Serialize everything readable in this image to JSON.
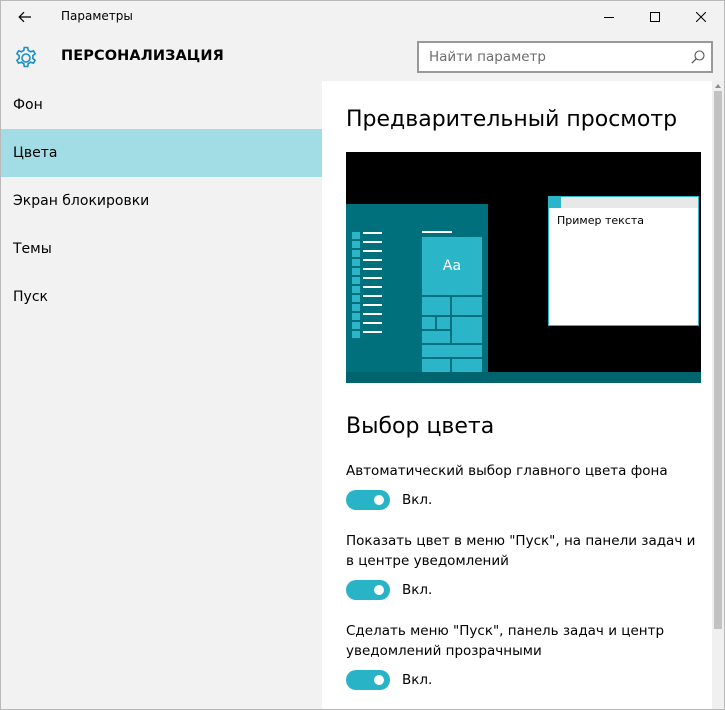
{
  "window": {
    "title": "Параметры"
  },
  "header": {
    "title": "ПЕРСОНАЛИЗАЦИЯ",
    "search_placeholder": "Найти параметр"
  },
  "sidebar": {
    "items": [
      {
        "label": "Фон",
        "active": false
      },
      {
        "label": "Цвета",
        "active": true
      },
      {
        "label": "Экран блокировки",
        "active": false
      },
      {
        "label": "Темы",
        "active": false
      },
      {
        "label": "Пуск",
        "active": false
      }
    ]
  },
  "main": {
    "preview_heading": "Предварительный просмотр",
    "preview": {
      "tile_label": "Aa",
      "sample_text": "Пример текста"
    },
    "color_heading": "Выбор цвета",
    "settings": [
      {
        "label": "Автоматический выбор главного цвета фона",
        "toggle_state": "Вкл.",
        "on": true
      },
      {
        "label": "Показать цвет в меню \"Пуск\", на панели задач и в центре уведомлений",
        "toggle_state": "Вкл.",
        "on": true
      },
      {
        "label": "Сделать меню \"Пуск\", панель задач и центр уведомлений прозрачными",
        "toggle_state": "Вкл.",
        "on": true
      }
    ]
  },
  "icons": {
    "back": "back-arrow-icon",
    "minimize": "minimize-icon",
    "maximize": "maximize-icon",
    "close": "close-icon",
    "settings": "gear-icon",
    "search": "search-icon"
  },
  "colors": {
    "accent": "#28b3c7",
    "selected_nav": "#a2dce4",
    "sidebar_bg": "#f2f2f2",
    "preview_start": "#00717c"
  }
}
